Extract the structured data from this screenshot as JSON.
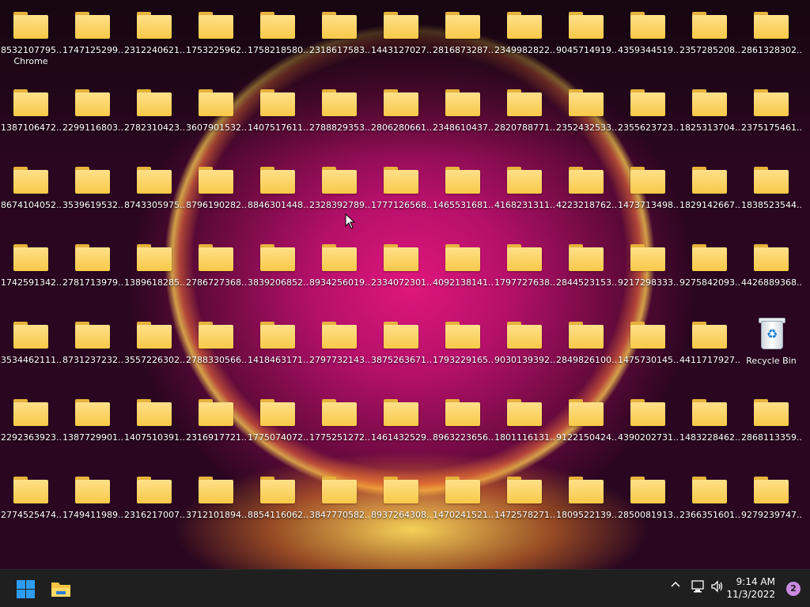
{
  "desktop": {
    "folders": [
      [
        "8532107795...",
        "1747125299...",
        "2312240621...",
        "1753225962...",
        "1758218580...",
        "2318617583...",
        "1443127027...",
        "2816873287...",
        "2349982822...",
        "9045714919...",
        "4359344519...",
        "2357285208...",
        "2861328302..."
      ],
      [
        "1387106472...",
        "2299116803...",
        "2782310423...",
        "3607901532...",
        "1407517611...",
        "2788829353...",
        "2806280661...",
        "2348610437...",
        "2820788771...",
        "2352432533...",
        "2355623723...",
        "1825313704...",
        "2375175461..."
      ],
      [
        "8674104052...",
        "3539619532...",
        "8743305975...",
        "8796190282...",
        "8846301448...",
        "2328392789...",
        "1777126568...",
        "1465531681...",
        "4168231311...",
        "4223218762...",
        "1473713498...",
        "1829142667...",
        "1838523544..."
      ],
      [
        "1742591342...",
        "2781713979...",
        "1389618285...",
        "2786727368...",
        "3839206852...",
        "8934256019...",
        "2334072301...",
        "4092138141...",
        "1797727638...",
        "2844523153...",
        "9217298333...",
        "9275842093...",
        "4426889368..."
      ],
      [
        "3534462111...",
        "8731237232...",
        "3557226302...",
        "2788330566...",
        "1418463171...",
        "2797732143...",
        "3875263671...",
        "1793229165...",
        "9030139392...",
        "2849826100...",
        "1475730145...",
        "4411717927..."
      ],
      [
        "2292363923...",
        "1387729901...",
        "1407510391...",
        "2316917721...",
        "1775074072...",
        "1775251272...",
        "1461432529...",
        "8963223656...",
        "1801116131...",
        "9122150424...",
        "4390202731...",
        "1483228462...",
        "2868113359..."
      ],
      [
        "2774525474...",
        "1749411989...",
        "2316217007...",
        "3712101894...",
        "8854116062...",
        "3847770582...",
        "8937264308...",
        "1470241521...",
        "1472578271...",
        "1809522139...",
        "2850081913...",
        "2366351601...",
        "9279239747..."
      ]
    ],
    "first_icon_second_line": "Chrome",
    "recycle_bin_label": "Recycle Bin"
  },
  "taskbar": {
    "start_icon": "windows-logo-icon",
    "pinned": [
      "file-explorer-icon"
    ],
    "tray": {
      "chevron": "^",
      "time": "9:14 AM",
      "date": "11/3/2022",
      "notification_count": "2"
    }
  },
  "colors": {
    "taskbar_bg": "#1f1f1f",
    "folder_yellow": "#f7c948",
    "accent_blue": "#2d9cf0",
    "notification_badge": "#c98ae0"
  }
}
